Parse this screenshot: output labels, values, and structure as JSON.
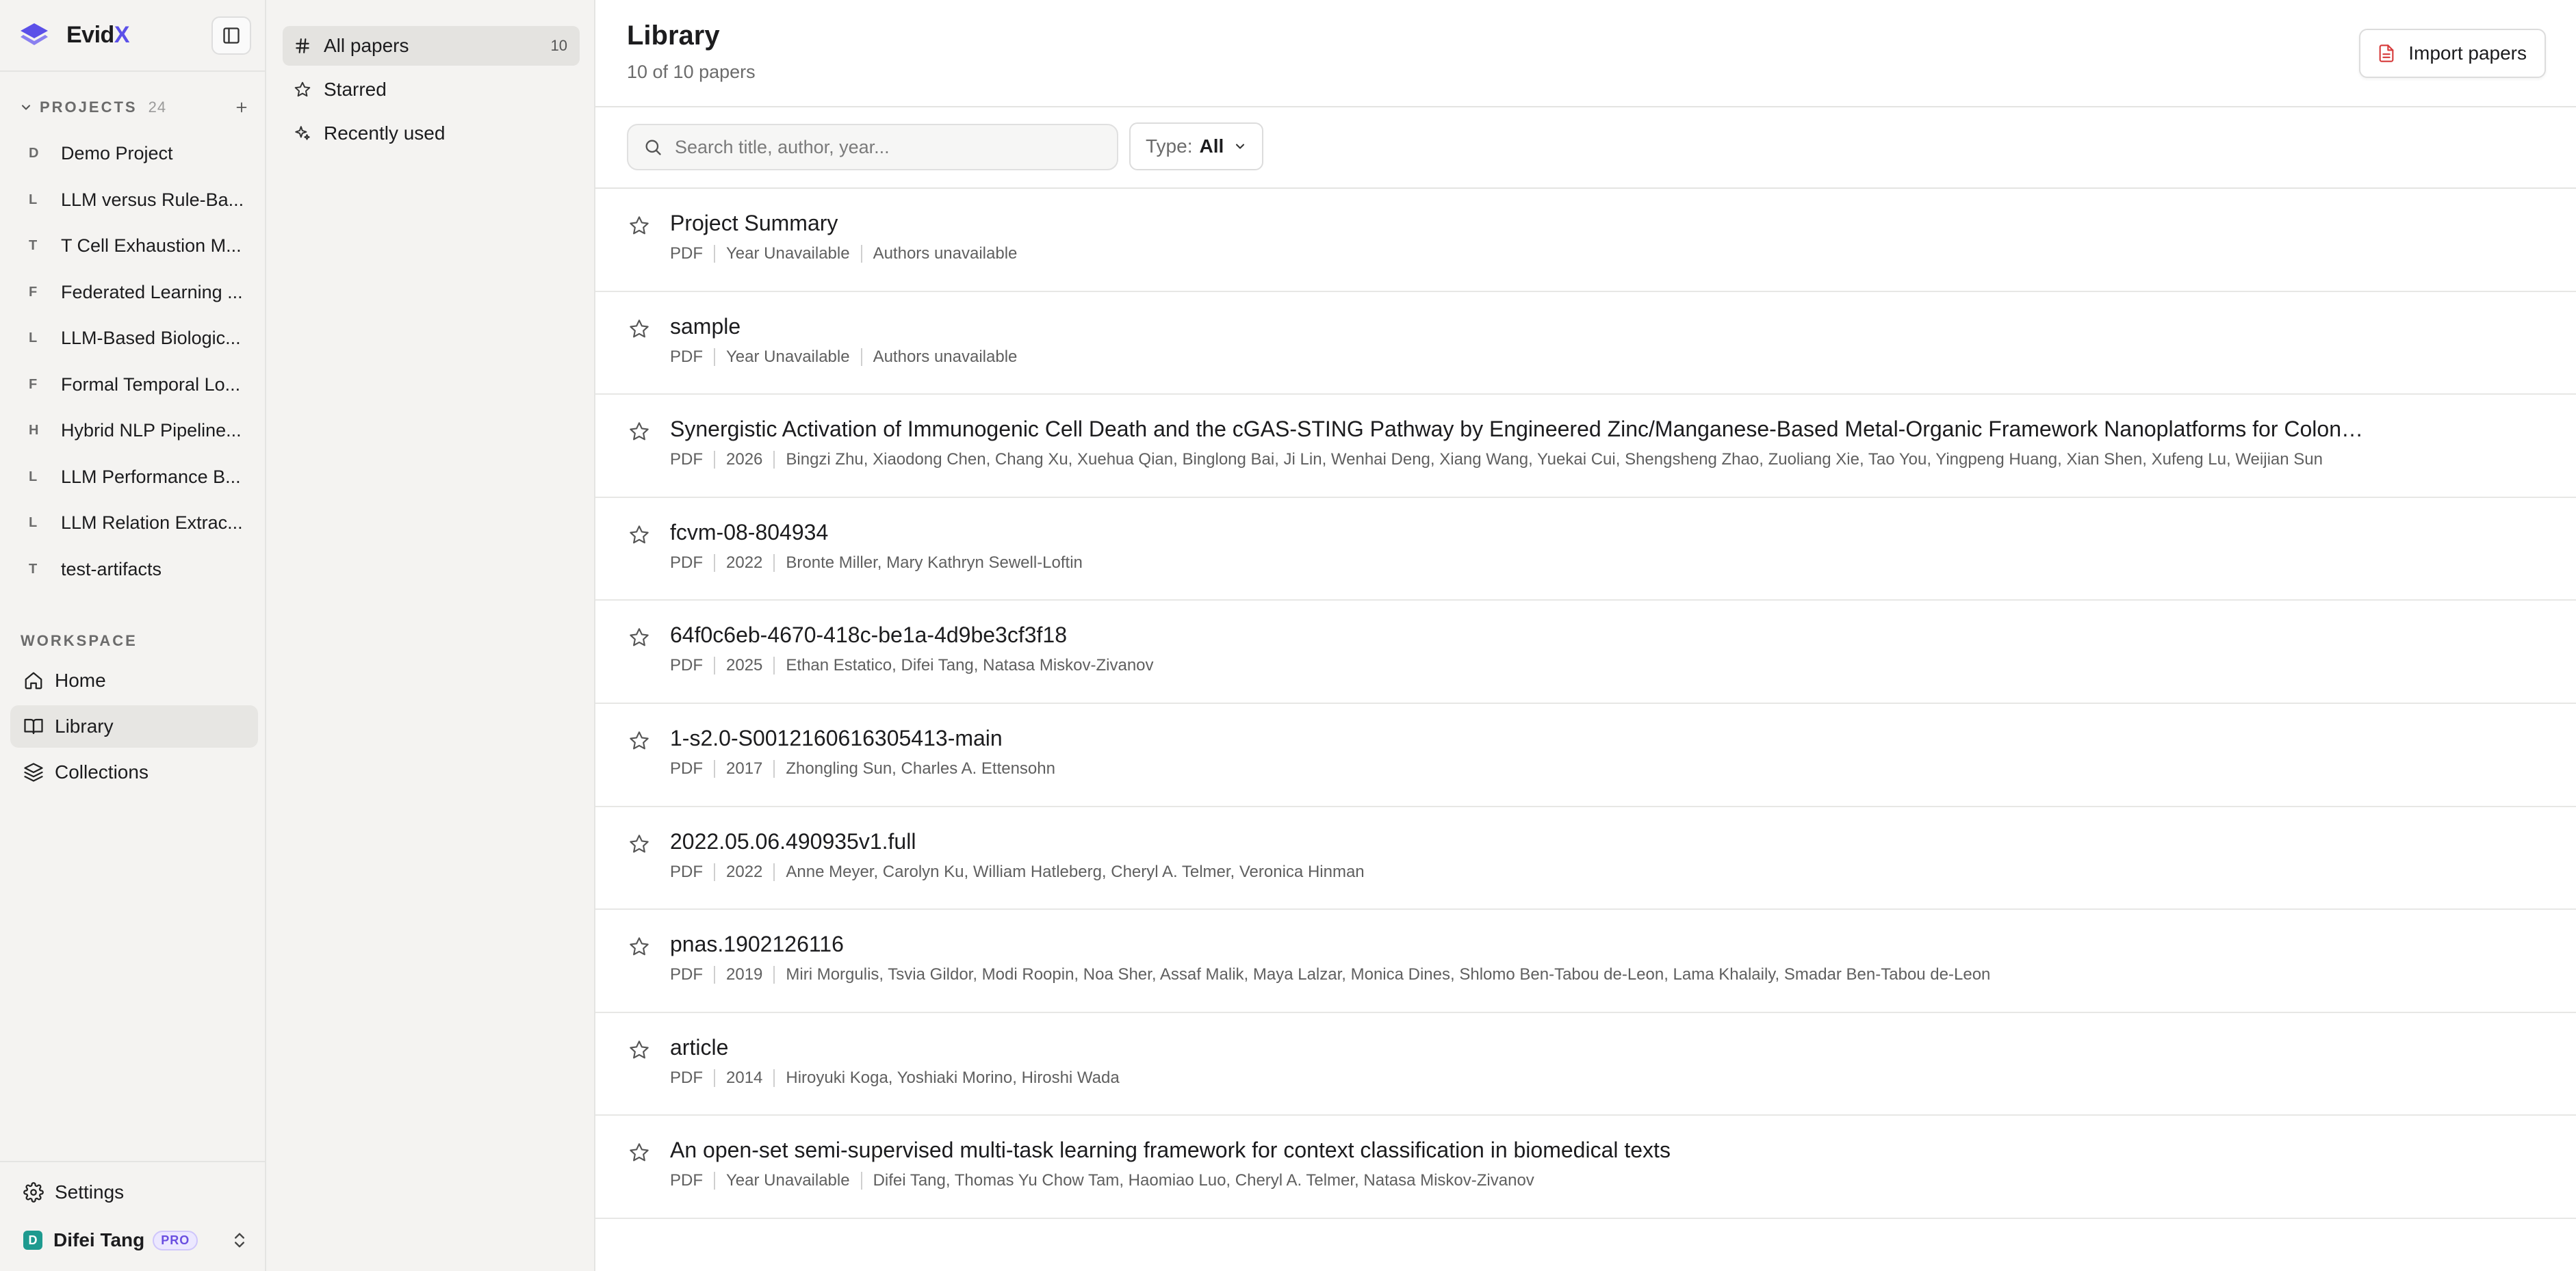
{
  "brand": {
    "name_prefix": "Evid",
    "name_accent": "X",
    "accent_color": "#5b50e8"
  },
  "projects": {
    "heading": "PROJECTS",
    "count": "24",
    "items": [
      {
        "initial": "D",
        "name": "Demo Project"
      },
      {
        "initial": "L",
        "name": "LLM versus Rule-Ba..."
      },
      {
        "initial": "T",
        "name": "T Cell Exhaustion M..."
      },
      {
        "initial": "F",
        "name": "Federated Learning ..."
      },
      {
        "initial": "L",
        "name": "LLM-Based Biologic..."
      },
      {
        "initial": "F",
        "name": "Formal Temporal Lo..."
      },
      {
        "initial": "H",
        "name": "Hybrid NLP Pipeline..."
      },
      {
        "initial": "L",
        "name": "LLM Performance B..."
      },
      {
        "initial": "L",
        "name": "LLM Relation Extrac..."
      },
      {
        "initial": "T",
        "name": "test-artifacts"
      }
    ]
  },
  "workspace": {
    "heading": "WORKSPACE",
    "items": [
      {
        "label": "Home",
        "icon": "home-icon"
      },
      {
        "label": "Library",
        "icon": "book-icon"
      },
      {
        "label": "Collections",
        "icon": "layers-icon"
      }
    ]
  },
  "footer": {
    "settings_label": "Settings",
    "user_initial": "D",
    "user_name": "Difei Tang",
    "plan_badge": "PRO"
  },
  "filters": {
    "items": [
      {
        "label": "All papers",
        "count": "10",
        "icon": "hash-icon"
      },
      {
        "label": "Starred",
        "count": "",
        "icon": "star-icon"
      },
      {
        "label": "Recently used",
        "count": "",
        "icon": "sparkles-icon"
      }
    ]
  },
  "header": {
    "title": "Library",
    "subtitle": "10 of 10 papers",
    "import_label": "Import papers"
  },
  "toolbar": {
    "search_placeholder": "Search title, author, year...",
    "search_value": "",
    "type_label": "Type:",
    "type_value": "All"
  },
  "papers": [
    {
      "title": "Project Summary",
      "type": "PDF",
      "year": "Year Unavailable",
      "authors": "Authors unavailable"
    },
    {
      "title": "sample",
      "type": "PDF",
      "year": "Year Unavailable",
      "authors": "Authors unavailable"
    },
    {
      "title": "Synergistic Activation of Immunogenic Cell Death and the cGAS-STING Pathway by Engineered Zinc/Manganese-Based Metal-Organic Framework Nanoplatforms for Colon Cancer I...",
      "type": "PDF",
      "year": "2026",
      "authors": "Bingzi Zhu, Xiaodong Chen, Chang Xu, Xuehua Qian, Binglong Bai, Ji Lin, Wenhai Deng, Xiang Wang, Yuekai Cui, Shengsheng Zhao, Zuoliang Xie, Tao You, Yingpeng Huang, Xian Shen, Xufeng Lu, Weijian Sun"
    },
    {
      "title": "fcvm-08-804934",
      "type": "PDF",
      "year": "2022",
      "authors": "Bronte Miller, Mary Kathryn Sewell-Loftin"
    },
    {
      "title": "64f0c6eb-4670-418c-be1a-4d9be3cf3f18",
      "type": "PDF",
      "year": "2025",
      "authors": "Ethan Estatico, Difei Tang, Natasa Miskov-Zivanov"
    },
    {
      "title": "1-s2.0-S0012160616305413-main",
      "type": "PDF",
      "year": "2017",
      "authors": "Zhongling Sun, Charles A. Ettensohn"
    },
    {
      "title": "2022.05.06.490935v1.full",
      "type": "PDF",
      "year": "2022",
      "authors": "Anne Meyer, Carolyn Ku, William Hatleberg, Cheryl A. Telmer, Veronica Hinman"
    },
    {
      "title": "pnas.1902126116",
      "type": "PDF",
      "year": "2019",
      "authors": "Miri Morgulis, Tsvia Gildor, Modi Roopin, Noa Sher, Assaf Malik, Maya Lalzar, Monica Dines, Shlomo Ben-Tabou de-Leon, Lama Khalaily, Smadar Ben-Tabou de-Leon"
    },
    {
      "title": "article",
      "type": "PDF",
      "year": "2014",
      "authors": "Hiroyuki Koga, Yoshiaki Morino, Hiroshi Wada"
    },
    {
      "title": "An open-set semi-supervised multi-task learning framework for context classification in biomedical texts",
      "type": "PDF",
      "year": "Year Unavailable",
      "authors": "Difei Tang, Thomas Yu Chow Tam, Haomiao Luo, Cheryl A. Telmer, Natasa Miskov-Zivanov"
    }
  ]
}
